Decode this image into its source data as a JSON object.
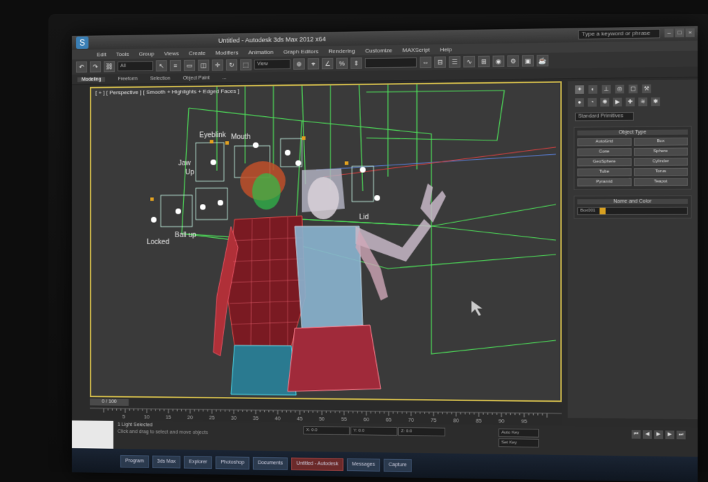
{
  "app": {
    "title": "Untitled - Autodesk 3ds Max 2012 x64",
    "search_placeholder": "Type a keyword or phrase"
  },
  "menu": [
    "Edit",
    "Tools",
    "Group",
    "Views",
    "Create",
    "Modifiers",
    "Animation",
    "Graph Editors",
    "Rendering",
    "Customize",
    "MAXScript",
    "Help"
  ],
  "toolbar": {
    "selection_filter": "All",
    "view_select": "View"
  },
  "ribbon": {
    "tabs": [
      "Modeling",
      "Freeform",
      "Selection",
      "Object Paint",
      "..."
    ]
  },
  "viewport": {
    "label": "[ + ] [ Perspective ] [ Smooth + Highlights + Edged Faces ]",
    "rig_labels": [
      "Locked",
      "Ball up",
      "Eyeblink",
      "Jaw",
      "Up",
      "Mouth",
      "Lid"
    ]
  },
  "command_panel": {
    "dropdown": "Standard Primitives",
    "rollout_title": "Object Type",
    "objects": [
      "AutoGrid",
      "Box",
      "Cone",
      "Sphere",
      "GeoSphere",
      "Cylinder",
      "Tube",
      "Torus",
      "Pyramid",
      "Teapot"
    ],
    "name_title": "Name and Color",
    "name_value": "Box001"
  },
  "timeline": {
    "slider": "0 / 100",
    "ticks": [
      "5",
      "10",
      "15",
      "20",
      "25",
      "30",
      "35",
      "40",
      "45",
      "50",
      "55",
      "60",
      "65",
      "70",
      "75",
      "80",
      "85",
      "90",
      "95"
    ]
  },
  "status": {
    "line1": "1 Light Selected",
    "line2": "Click and drag to select and move objects",
    "x": "X: 0.0",
    "y": "Y: 0.0",
    "z": "Z: 0.0",
    "autokey": "Auto Key",
    "setkey": "Set Key"
  },
  "taskbar": {
    "items": [
      "Program",
      "3ds Max",
      "Explorer",
      "Photoshop",
      "Documents",
      "Untitled - Autodesk",
      "Messages",
      "Capture"
    ]
  },
  "colors": {
    "viewport_border": "#c9b44a",
    "wire_green": "#4ee05a",
    "wire_cyan": "#49d8e8",
    "wire_red": "#e04040"
  }
}
